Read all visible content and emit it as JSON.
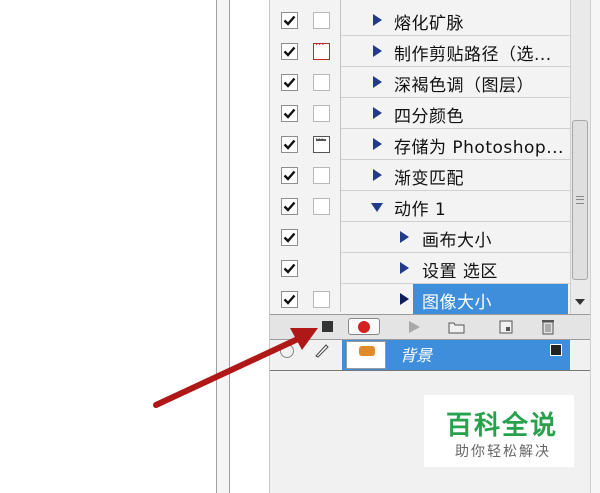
{
  "actions": [
    {
      "label": "熔化矿脉",
      "checked": true,
      "dialog": "empty",
      "expanded": false
    },
    {
      "label": "制作剪贴路径（选...",
      "checked": true,
      "dialog": "red",
      "expanded": false
    },
    {
      "label": "深褐色调（图层）",
      "checked": true,
      "dialog": "empty",
      "expanded": false
    },
    {
      "label": "四分颜色",
      "checked": true,
      "dialog": "empty",
      "expanded": false
    },
    {
      "label": "存储为 Photoshop...",
      "checked": true,
      "dialog": "dark",
      "expanded": false
    },
    {
      "label": "渐变匹配",
      "checked": true,
      "dialog": "empty",
      "expanded": false
    },
    {
      "label": "动作 1",
      "checked": true,
      "dialog": "empty",
      "expanded": true
    },
    {
      "label": "画布大小",
      "checked": true,
      "dialog": "none",
      "expanded": false,
      "child": true
    },
    {
      "label": "设置 选区",
      "checked": true,
      "dialog": "none",
      "expanded": false,
      "child": true
    },
    {
      "label": "图像大小",
      "checked": true,
      "dialog": "empty",
      "expanded": false,
      "child": true,
      "selected": true
    }
  ],
  "layer": {
    "name": "背景"
  },
  "watermark": {
    "logo": "百科全说",
    "subtitle": "助你轻松解决"
  },
  "colors": {
    "selection": "#3f8edb",
    "record": "#d42020",
    "arrow": "#b01818",
    "brand": "#27a14c"
  },
  "icons": [
    "stop-icon",
    "record-icon",
    "play-icon",
    "new-set-icon",
    "new-action-icon",
    "trash-icon"
  ]
}
